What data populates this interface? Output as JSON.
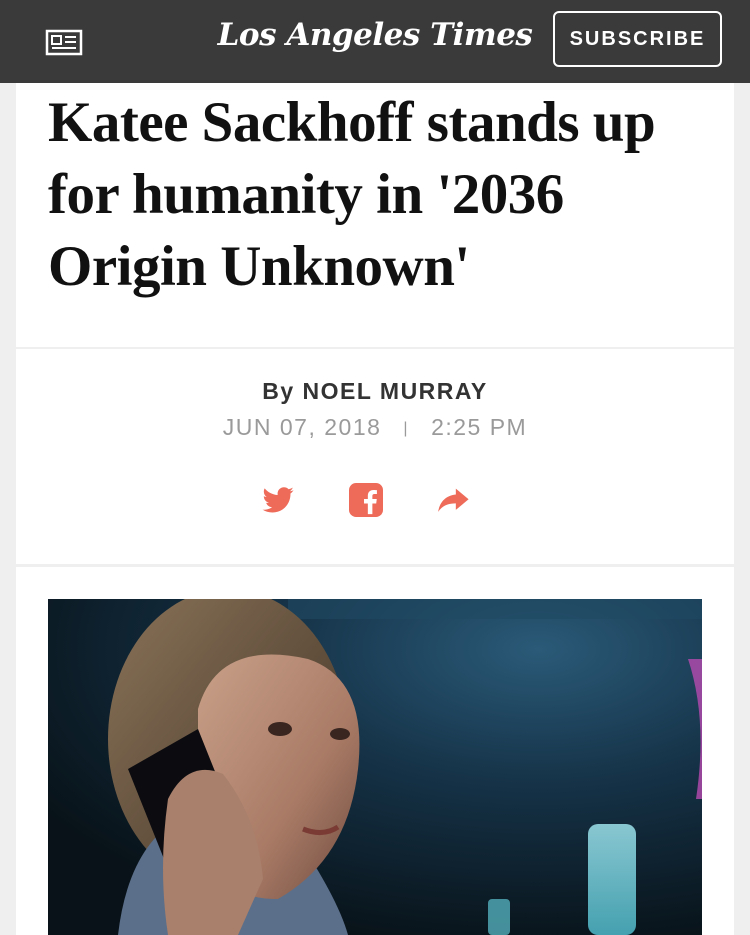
{
  "header": {
    "logo_text": "Los Angeles Times",
    "subscribe_label": "SUBSCRIBE",
    "menu_icon": "newspaper-icon",
    "background_color": "#3a3a3a"
  },
  "article": {
    "headline": "Katee Sackhoff stands up for humanity in '2036 Origin Unknown'",
    "byline_prefix": "By",
    "author": "NOEL MURRAY",
    "date": "JUN 07, 2018",
    "separator": "|",
    "time": "2:25 PM"
  },
  "share": {
    "icons": [
      "twitter-icon",
      "facebook-icon",
      "share-arrow-icon"
    ],
    "accent_color": "#ee6b5a"
  },
  "media": {
    "image_description_icon": "article-photo"
  }
}
